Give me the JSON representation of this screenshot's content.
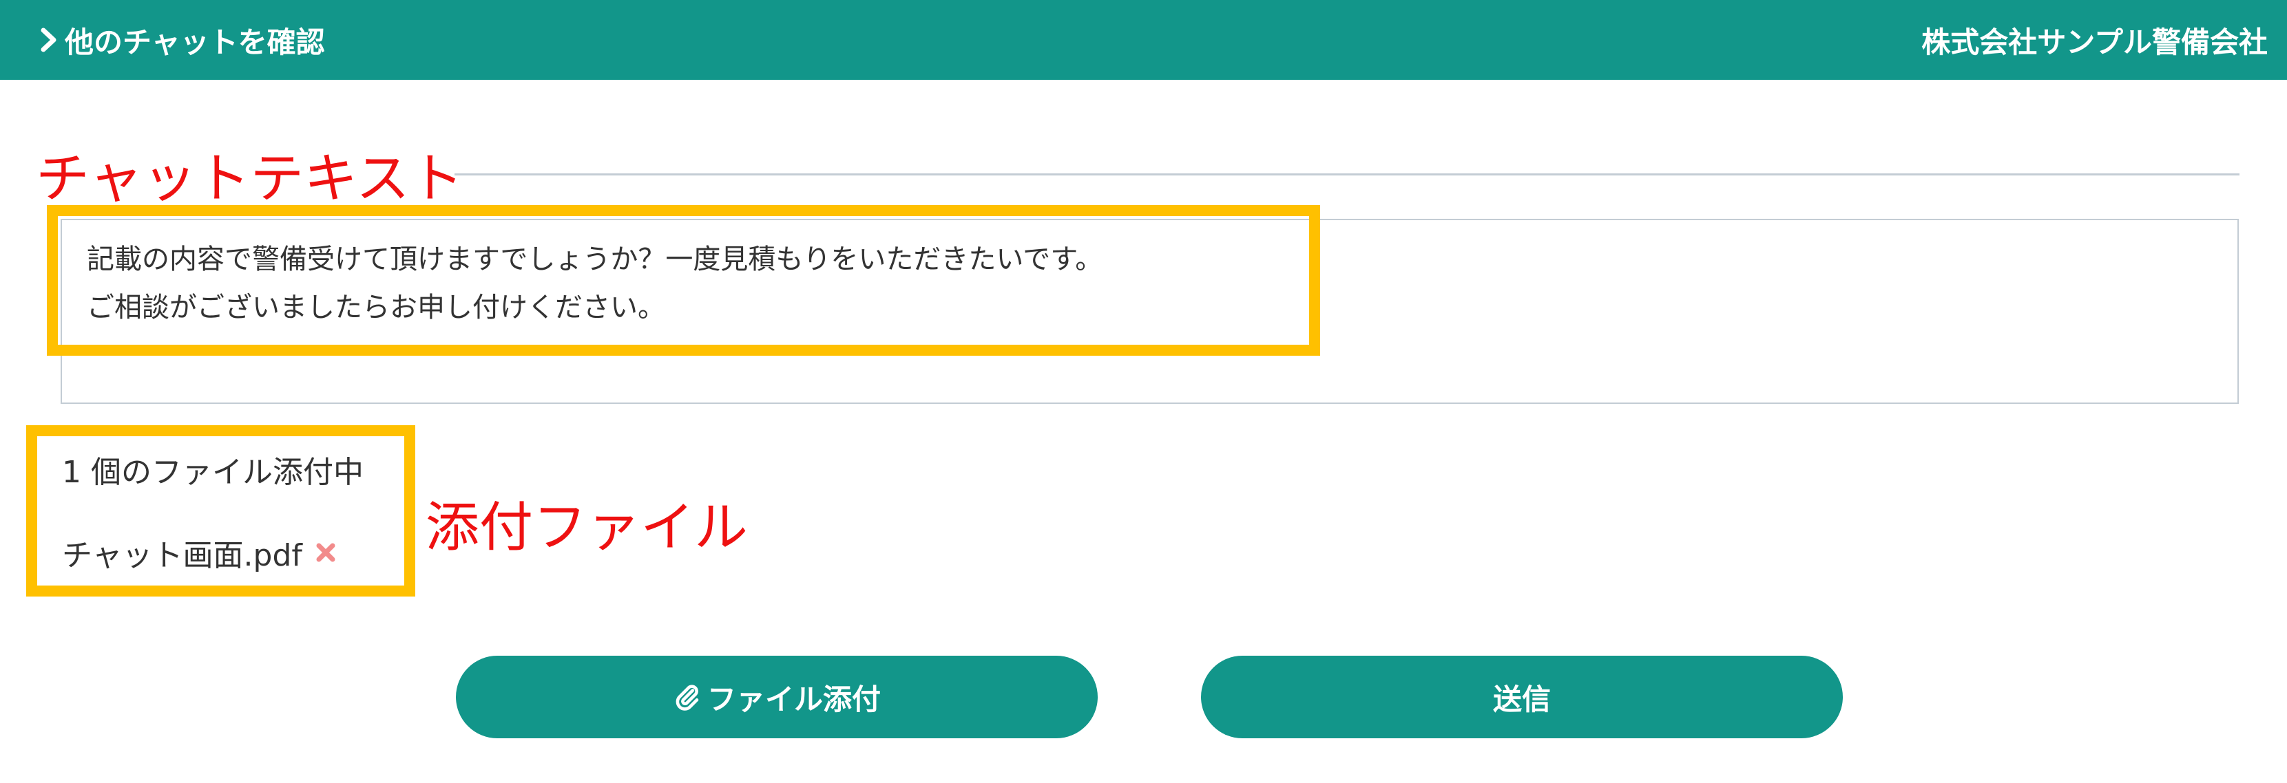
{
  "header": {
    "more_chats_label": "他のチャットを確認",
    "company_name": "株式会社サンプル警備会社"
  },
  "annotations": {
    "chat_text": "チャットテキスト",
    "attachment": "添付ファイル"
  },
  "message": {
    "value": "記載の内容で警備受けて頂けますでしょうか？一度見積もりをいただきたいです。\nご相談がございましたらお申し付けください。"
  },
  "attachments": {
    "count_label": "1 個のファイル添付中",
    "files": [
      {
        "name": "チャット画面.pdf"
      }
    ]
  },
  "actions": {
    "attach_label": "ファイル添付",
    "send_label": "送信"
  },
  "colors": {
    "primary": "#12968a",
    "annotation_text": "#ee1111",
    "highlight_box": "#ffc000",
    "remove_icon": "#f28b8b"
  },
  "icons": {
    "more_chats": "chevron-right-icon",
    "remove_file": "close-icon",
    "attach": "paperclip-icon"
  }
}
